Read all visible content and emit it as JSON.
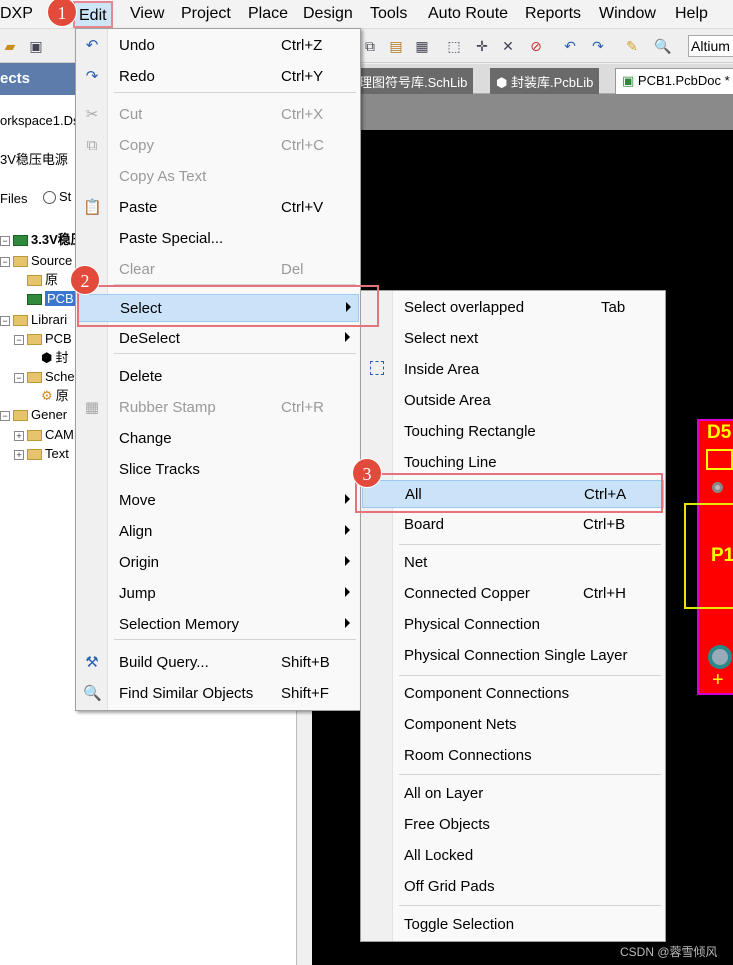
{
  "menubar": {
    "items": [
      "DXP",
      "Edit",
      "View",
      "Project",
      "Place",
      "Design",
      "Tools",
      "Auto Route",
      "Reports",
      "Window",
      "Help"
    ]
  },
  "toolbar": {
    "combo_value": "Altium"
  },
  "panel": {
    "header": "ects",
    "workspace": "orkspace1.Ds",
    "project": "3V稳压电源",
    "files_label": "Files",
    "radio_label": "St",
    "tree": [
      "3.3V稳压",
      "Source",
      "原",
      "PCB",
      "Librari",
      "PCB",
      "封",
      "Sche",
      "原",
      "Gener",
      "CAM",
      "Text"
    ]
  },
  "tabs": [
    "理图符号库.SchLib",
    "封装库.PcbLib",
    "PCB1.PcbDoc *"
  ],
  "board": {
    "label_d5": "D5",
    "label_p1": "P1",
    "label_plus": "+"
  },
  "edit_menu": {
    "items": [
      {
        "label": "Undo",
        "shortcut": "Ctrl+Z",
        "icon": "undo-icon",
        "glyph": "↶"
      },
      {
        "label": "Redo",
        "shortcut": "Ctrl+Y",
        "icon": "redo-icon",
        "glyph": "↷"
      },
      {
        "label": "Cut",
        "shortcut": "Ctrl+X",
        "icon": "scissors-icon",
        "glyph": "✂"
      },
      {
        "label": "Copy",
        "shortcut": "Ctrl+C",
        "icon": "copy-icon",
        "glyph": "⧉"
      },
      {
        "label": "Copy As Text",
        "shortcut": "",
        "icon": "",
        "glyph": ""
      },
      {
        "label": "Paste",
        "shortcut": "Ctrl+V",
        "icon": "paste-icon",
        "glyph": "📋"
      },
      {
        "label": "Paste Special...",
        "shortcut": "",
        "icon": "",
        "glyph": ""
      },
      {
        "label": "Clear",
        "shortcut": "Del",
        "icon": "",
        "glyph": ""
      },
      {
        "label": "Select",
        "shortcut": "",
        "icon": "",
        "glyph": ""
      },
      {
        "label": "DeSelect",
        "shortcut": "",
        "icon": "",
        "glyph": ""
      },
      {
        "label": "Delete",
        "shortcut": "",
        "icon": "",
        "glyph": ""
      },
      {
        "label": "Rubber Stamp",
        "shortcut": "Ctrl+R",
        "icon": "stamp-icon",
        "glyph": "▦"
      },
      {
        "label": "Change",
        "shortcut": "",
        "icon": "",
        "glyph": ""
      },
      {
        "label": "Slice Tracks",
        "shortcut": "",
        "icon": "",
        "glyph": ""
      },
      {
        "label": "Move",
        "shortcut": "",
        "icon": "",
        "glyph": ""
      },
      {
        "label": "Align",
        "shortcut": "",
        "icon": "",
        "glyph": ""
      },
      {
        "label": "Origin",
        "shortcut": "",
        "icon": "",
        "glyph": ""
      },
      {
        "label": "Jump",
        "shortcut": "",
        "icon": "",
        "glyph": ""
      },
      {
        "label": "Selection Memory",
        "shortcut": "",
        "icon": "",
        "glyph": ""
      },
      {
        "label": "Build Query...",
        "shortcut": "Shift+B",
        "icon": "hammer-icon",
        "glyph": "⚒"
      },
      {
        "label": "Find Similar Objects",
        "shortcut": "Shift+F",
        "icon": "magnifier-icon",
        "glyph": "🔍"
      }
    ]
  },
  "select_menu": {
    "items": [
      {
        "label": "Select overlapped",
        "shortcut": "Tab"
      },
      {
        "label": "Select next",
        "shortcut": ""
      },
      {
        "label": "Inside Area",
        "shortcut": ""
      },
      {
        "label": "Outside Area",
        "shortcut": ""
      },
      {
        "label": "Touching Rectangle",
        "shortcut": ""
      },
      {
        "label": "Touching Line",
        "shortcut": ""
      },
      {
        "label": "All",
        "shortcut": "Ctrl+A"
      },
      {
        "label": "Board",
        "shortcut": "Ctrl+B"
      },
      {
        "label": "Net",
        "shortcut": ""
      },
      {
        "label": "Connected Copper",
        "shortcut": "Ctrl+H"
      },
      {
        "label": "Physical Connection",
        "shortcut": ""
      },
      {
        "label": "Physical Connection Single Layer",
        "shortcut": ""
      },
      {
        "label": "Component Connections",
        "shortcut": ""
      },
      {
        "label": "Component Nets",
        "shortcut": ""
      },
      {
        "label": "Room Connections",
        "shortcut": ""
      },
      {
        "label": "All on Layer",
        "shortcut": ""
      },
      {
        "label": "Free Objects",
        "shortcut": ""
      },
      {
        "label": "All Locked",
        "shortcut": ""
      },
      {
        "label": "Off Grid Pads",
        "shortcut": ""
      },
      {
        "label": "Toggle Selection",
        "shortcut": ""
      }
    ]
  },
  "badges": [
    "1",
    "2",
    "3"
  ],
  "watermark": "CSDN @蓉雪倾风"
}
